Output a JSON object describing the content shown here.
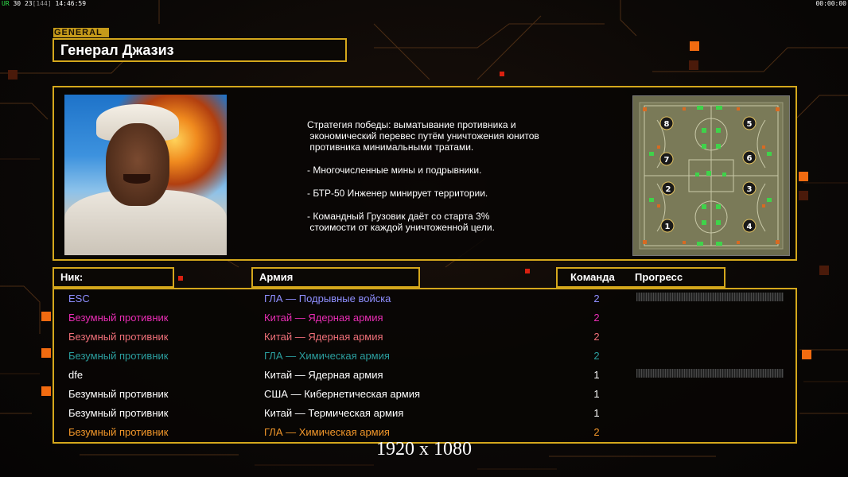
{
  "hud": {
    "left": {
      "a": "UR",
      "b": "30",
      "c": "23",
      "d": "[144]",
      "time": "14:46:59"
    },
    "right": "00:00:00"
  },
  "general": {
    "tag": "GENERAL",
    "name": "Генерал Джазиз"
  },
  "strategy": [
    "Стратегия победы: выматывание противника и\n экономический перевес путём уничтожения юнитов\n противника минимальными тратами.",
    "- Многочисленные мины и подрывники.",
    "- БТР-50 Инженер минирует территории.",
    "- Командный Грузовик даёт со старта 3%\n стоимости от каждой уничтоженной цели."
  ],
  "map": {
    "slots": [
      "8",
      "5",
      "7",
      "6",
      "2",
      "3",
      "1",
      "4"
    ]
  },
  "columns": {
    "nick": "Ник:",
    "army": "Армия",
    "team": "Команда",
    "progress": "Прогресс"
  },
  "players": [
    {
      "nick": "ESC",
      "army": "ГЛА — Подрывные войска",
      "team": "2",
      "color": "#8f8fff",
      "progress": true
    },
    {
      "nick": "Безумный противник",
      "army": "Китай — Ядерная армия",
      "team": "2",
      "color": "#e92db4",
      "progress": false
    },
    {
      "nick": "Безумный противник",
      "army": "Китай — Ядерная армия",
      "team": "2",
      "color": "#ee6f78",
      "progress": false
    },
    {
      "nick": "Безумный противник",
      "army": "ГЛА — Химическая армия",
      "team": "2",
      "color": "#2b9e9e",
      "progress": false
    },
    {
      "nick": "dfe",
      "army": "Китай — Ядерная армия",
      "team": "1",
      "color": "#ffffff",
      "progress": true
    },
    {
      "nick": "Безумный противник",
      "army": "США — Кибернетическая армия",
      "team": "1",
      "color": "#ffffff",
      "progress": false
    },
    {
      "nick": "Безумный противник",
      "army": "Китай — Термическая армия",
      "team": "1",
      "color": "#ffffff",
      "progress": false
    },
    {
      "nick": "Безумный противник",
      "army": "ГЛА — Химическая армия",
      "team": "2",
      "color": "#f0962a",
      "progress": false
    }
  ],
  "resolution": "1920 x 1080",
  "colors": {
    "accent": "#d4a71c",
    "highlight": "#f26b10"
  }
}
